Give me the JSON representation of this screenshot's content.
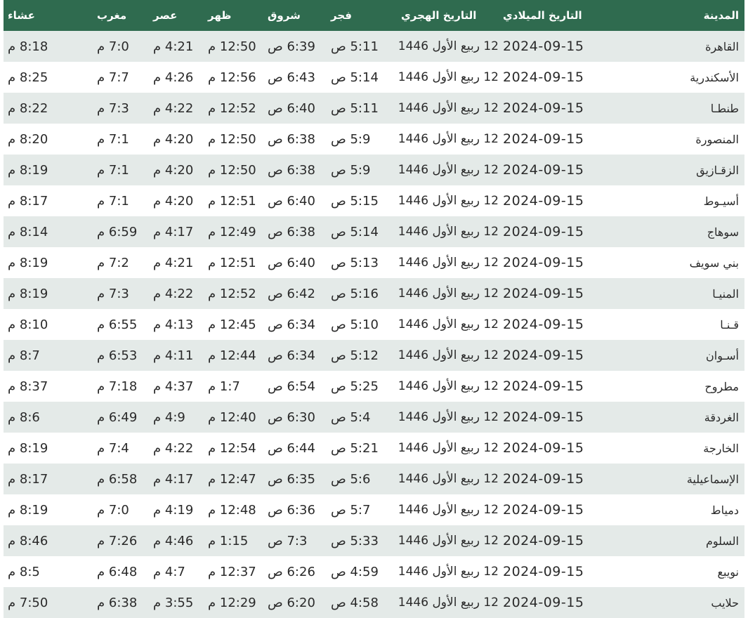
{
  "headers": {
    "city": "المدينة",
    "gregorian": "التاريخ الميلادي",
    "hijri": "التاريخ الهجري",
    "fajr": "فجر",
    "shuruq": "شروق",
    "dhuhr": "ظهر",
    "asr": "عصر",
    "maghrib": "مغرب",
    "isha": "عشاء"
  },
  "rows": [
    {
      "city": "القاهرة",
      "gregorian": "2024-09-15",
      "hijri": "12 ربيع الأول 1446",
      "fajr": "5:11 ص",
      "shuruq": "6:39 ص",
      "dhuhr": "12:50 م",
      "asr": "4:21 م",
      "maghrib": "7:0 م",
      "isha": "8:18 م"
    },
    {
      "city": "الأسكندرية",
      "gregorian": "2024-09-15",
      "hijri": "12 ربيع الأول 1446",
      "fajr": "5:14 ص",
      "shuruq": "6:43 ص",
      "dhuhr": "12:56 م",
      "asr": "4:26 م",
      "maghrib": "7:7 م",
      "isha": "8:25 م"
    },
    {
      "city": "طنطـا",
      "gregorian": "2024-09-15",
      "hijri": "12 ربيع الأول 1446",
      "fajr": "5:11 ص",
      "shuruq": "6:40 ص",
      "dhuhr": "12:52 م",
      "asr": "4:22 م",
      "maghrib": "7:3 م",
      "isha": "8:22 م"
    },
    {
      "city": "المنصورة",
      "gregorian": "2024-09-15",
      "hijri": "12 ربيع الأول 1446",
      "fajr": "5:9 ص",
      "shuruq": "6:38 ص",
      "dhuhr": "12:50 م",
      "asr": "4:20 م",
      "maghrib": "7:1 م",
      "isha": "8:20 م"
    },
    {
      "city": "الزقـازيق",
      "gregorian": "2024-09-15",
      "hijri": "12 ربيع الأول 1446",
      "fajr": "5:9 ص",
      "shuruq": "6:38 ص",
      "dhuhr": "12:50 م",
      "asr": "4:20 م",
      "maghrib": "7:1 م",
      "isha": "8:19 م"
    },
    {
      "city": "أسيـوط",
      "gregorian": "2024-09-15",
      "hijri": "12 ربيع الأول 1446",
      "fajr": "5:15 ص",
      "shuruq": "6:40 ص",
      "dhuhr": "12:51 م",
      "asr": "4:20 م",
      "maghrib": "7:1 م",
      "isha": "8:17 م"
    },
    {
      "city": "سوهاج",
      "gregorian": "2024-09-15",
      "hijri": "12 ربيع الأول 1446",
      "fajr": "5:14 ص",
      "shuruq": "6:38 ص",
      "dhuhr": "12:49 م",
      "asr": "4:17 م",
      "maghrib": "6:59 م",
      "isha": "8:14 م"
    },
    {
      "city": "بني سويف",
      "gregorian": "2024-09-15",
      "hijri": "12 ربيع الأول 1446",
      "fajr": "5:13 ص",
      "shuruq": "6:40 ص",
      "dhuhr": "12:51 م",
      "asr": "4:21 م",
      "maghrib": "7:2 م",
      "isha": "8:19 م"
    },
    {
      "city": "المنيـا",
      "gregorian": "2024-09-15",
      "hijri": "12 ربيع الأول 1446",
      "fajr": "5:16 ص",
      "shuruq": "6:42 ص",
      "dhuhr": "12:52 م",
      "asr": "4:22 م",
      "maghrib": "7:3 م",
      "isha": "8:19 م"
    },
    {
      "city": "قـنـا",
      "gregorian": "2024-09-15",
      "hijri": "12 ربيع الأول 1446",
      "fajr": "5:10 ص",
      "shuruq": "6:34 ص",
      "dhuhr": "12:45 م",
      "asr": "4:13 م",
      "maghrib": "6:55 م",
      "isha": "8:10 م"
    },
    {
      "city": "أسـوان",
      "gregorian": "2024-09-15",
      "hijri": "12 ربيع الأول 1446",
      "fajr": "5:12 ص",
      "shuruq": "6:34 ص",
      "dhuhr": "12:44 م",
      "asr": "4:11 م",
      "maghrib": "6:53 م",
      "isha": "8:7 م"
    },
    {
      "city": "مطروح",
      "gregorian": "2024-09-15",
      "hijri": "12 ربيع الأول 1446",
      "fajr": "5:25 ص",
      "shuruq": "6:54 ص",
      "dhuhr": "1:7 م",
      "asr": "4:37 م",
      "maghrib": "7:18 م",
      "isha": "8:37 م"
    },
    {
      "city": "الغردقة",
      "gregorian": "2024-09-15",
      "hijri": "12 ربيع الأول 1446",
      "fajr": "5:4 ص",
      "shuruq": "6:30 ص",
      "dhuhr": "12:40 م",
      "asr": "4:9 م",
      "maghrib": "6:49 م",
      "isha": "8:6 م"
    },
    {
      "city": "الخارجة",
      "gregorian": "2024-09-15",
      "hijri": "12 ربيع الأول 1446",
      "fajr": "5:21 ص",
      "shuruq": "6:44 ص",
      "dhuhr": "12:54 م",
      "asr": "4:22 م",
      "maghrib": "7:4 م",
      "isha": "8:19 م"
    },
    {
      "city": "الإسماعيلية",
      "gregorian": "2024-09-15",
      "hijri": "12 ربيع الأول 1446",
      "fajr": "5:6 ص",
      "shuruq": "6:35 ص",
      "dhuhr": "12:47 م",
      "asr": "4:17 م",
      "maghrib": "6:58 م",
      "isha": "8:17 م"
    },
    {
      "city": "دمياط",
      "gregorian": "2024-09-15",
      "hijri": "12 ربيع الأول 1446",
      "fajr": "5:7 ص",
      "shuruq": "6:36 ص",
      "dhuhr": "12:48 م",
      "asr": "4:19 م",
      "maghrib": "7:0 م",
      "isha": "8:19 م"
    },
    {
      "city": "السلوم",
      "gregorian": "2024-09-15",
      "hijri": "12 ربيع الأول 1446",
      "fajr": "5:33 ص",
      "shuruq": "7:3 ص",
      "dhuhr": "1:15 م",
      "asr": "4:46 م",
      "maghrib": "7:26 م",
      "isha": "8:46 م"
    },
    {
      "city": "نويبع",
      "gregorian": "2024-09-15",
      "hijri": "12 ربيع الأول 1446",
      "fajr": "4:59 ص",
      "shuruq": "6:26 ص",
      "dhuhr": "12:37 م",
      "asr": "4:7 م",
      "maghrib": "6:48 م",
      "isha": "8:5 م"
    },
    {
      "city": "حلايب",
      "gregorian": "2024-09-15",
      "hijri": "12 ربيع الأول 1446",
      "fajr": "4:58 ص",
      "shuruq": "6:20 ص",
      "dhuhr": "12:29 م",
      "asr": "3:55 م",
      "maghrib": "6:38 م",
      "isha": "7:50 م"
    }
  ],
  "colors": {
    "header_bg": "#2f6b4f",
    "header_text": "#ffffff",
    "row_alt_bg": "#e4eae8",
    "row_bg": "#ffffff"
  }
}
